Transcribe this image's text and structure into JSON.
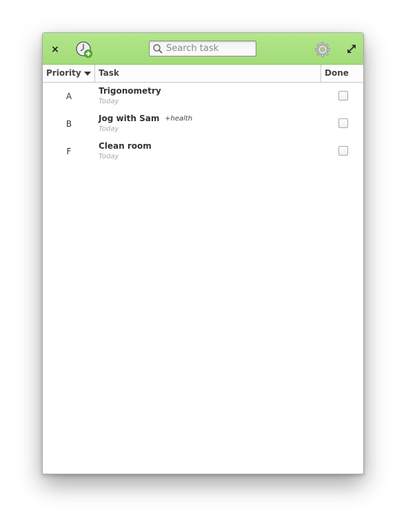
{
  "toolbar": {
    "close_label": "×",
    "add_task_icon": "clock-plus-icon",
    "settings_icon": "gear-icon",
    "maximize_icon": "maximize-arrows-icon"
  },
  "search": {
    "placeholder": "Search task",
    "value": ""
  },
  "columns": {
    "priority": "Priority",
    "task": "Task",
    "done": "Done",
    "sort": "priority-descending"
  },
  "tasks": [
    {
      "priority": "A",
      "name": "Trigonometry",
      "tag": "",
      "date": "Today",
      "done": false
    },
    {
      "priority": "B",
      "name": "Jog with Sam",
      "tag": "+health",
      "date": "Today",
      "done": false
    },
    {
      "priority": "F",
      "name": "Clean room",
      "tag": "",
      "date": "Today",
      "done": false
    }
  ],
  "colors": {
    "titlebar": "#a8e07e",
    "accent": "#8cc564"
  }
}
